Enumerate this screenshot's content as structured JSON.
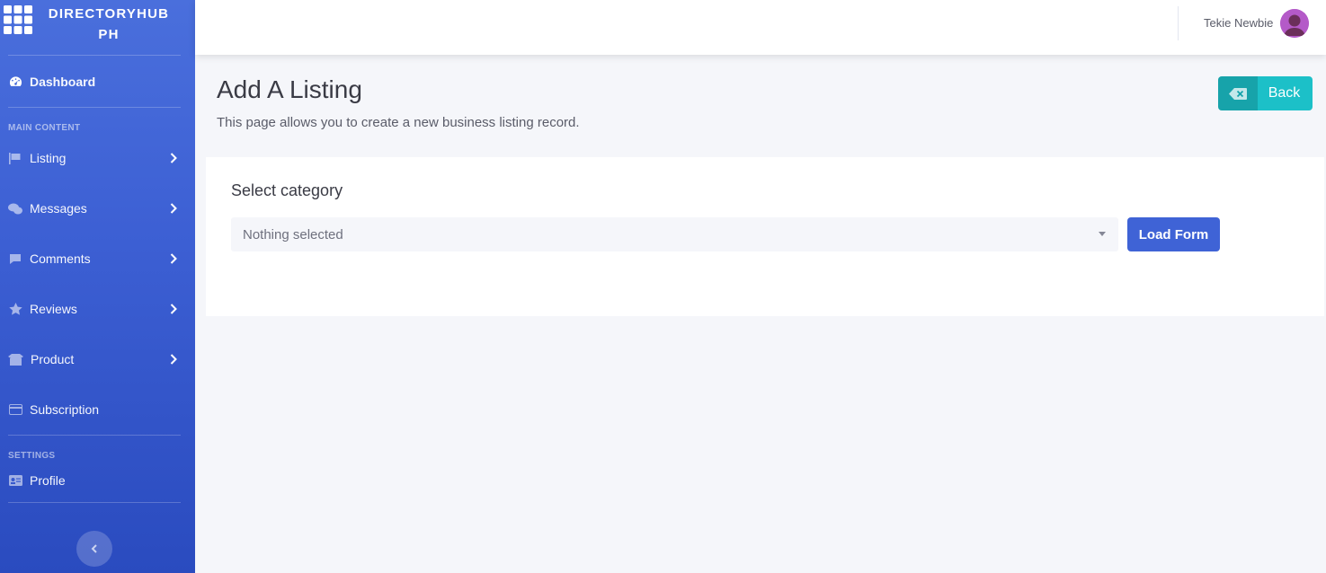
{
  "brand": {
    "line1": "DIRECTORYHUB",
    "line2": "PH",
    "icon": "grid-icon"
  },
  "sidebar": {
    "dashboard": {
      "label": "Dashboard",
      "icon": "gauge-icon"
    },
    "section_main": "MAIN CONTENT",
    "items": [
      {
        "label": "Listing",
        "icon": "flag-icon",
        "has_submenu": true
      },
      {
        "label": "Messages",
        "icon": "comments-icon",
        "has_submenu": true
      },
      {
        "label": "Comments",
        "icon": "comment-icon",
        "has_submenu": true
      },
      {
        "label": "Reviews",
        "icon": "star-icon",
        "has_submenu": true
      },
      {
        "label": "Product",
        "icon": "box-open-icon",
        "has_submenu": true
      },
      {
        "label": "Subscription",
        "icon": "credit-card-icon",
        "has_submenu": false
      }
    ],
    "section_settings": "SETTINGS",
    "profile": {
      "label": "Profile",
      "icon": "id-card-icon"
    }
  },
  "topbar": {
    "username": "Tekie Newbie"
  },
  "page": {
    "title": "Add A Listing",
    "description": "This page allows you to create a new business listing record.",
    "back_label": "Back"
  },
  "form": {
    "label": "Select category",
    "select_value": "Nothing selected",
    "load_label": "Load Form"
  },
  "colors": {
    "sidebar_gradient_top": "#4a6fdc",
    "sidebar_gradient_bottom": "#2a4bbf",
    "primary_button": "#3f63d6",
    "back_button": "#1cc0c8",
    "background": "#f5f6fa"
  }
}
